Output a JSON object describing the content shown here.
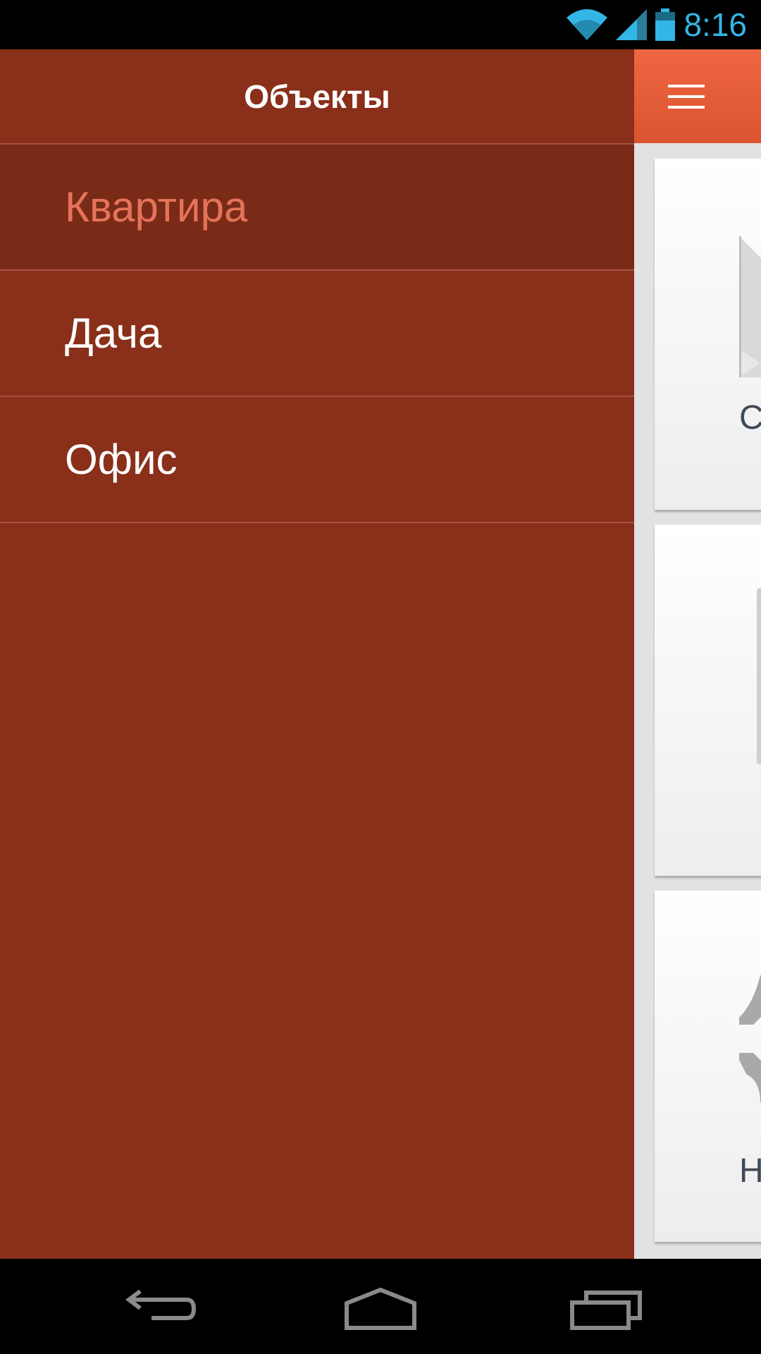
{
  "status_bar": {
    "time": "8:16",
    "icons": [
      "wifi-icon",
      "signal-icon",
      "battery-icon"
    ],
    "accent_color": "#33b5e5"
  },
  "drawer": {
    "title": "Объекты",
    "background_color": "#8a2f1a",
    "selected_text_color": "#e5735a",
    "items": [
      {
        "label": "Квартира",
        "selected": true
      },
      {
        "label": "Дача",
        "selected": false
      },
      {
        "label": "Офис",
        "selected": false
      }
    ]
  },
  "main": {
    "action_bar_color": "#e55c36",
    "menu_icon": "hamburger-menu-icon",
    "cards": [
      {
        "label": "С"
      },
      {
        "label": ""
      },
      {
        "label": "Н"
      }
    ]
  },
  "nav_bar": {
    "buttons": [
      "back-icon",
      "home-icon",
      "recent-apps-icon"
    ]
  }
}
